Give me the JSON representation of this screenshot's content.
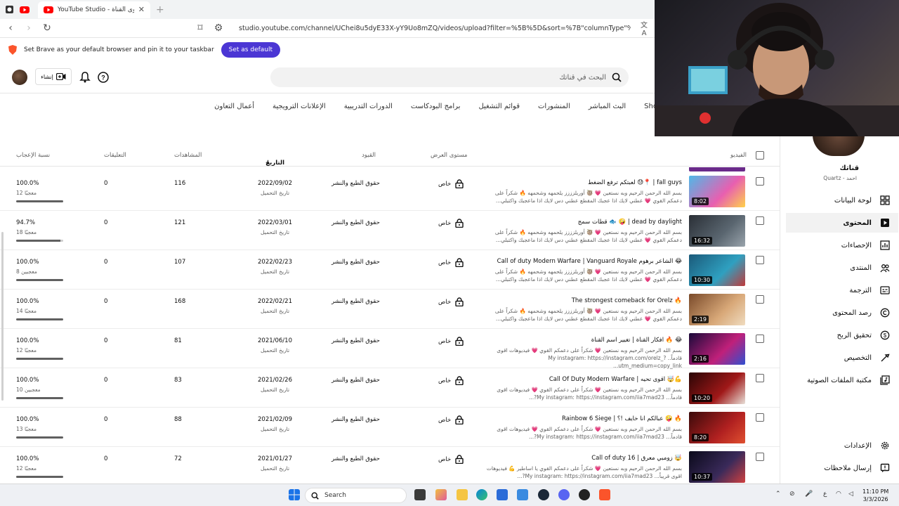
{
  "browser": {
    "tab_title": "YouTube Studio - محتوى القناة",
    "url": "studio.youtube.com/channel/UChei8u5dyE33X-yY9Uo8mZQ/videos/upload?filter=%5B%5D&sort=%7B\"columnType\"%3A\"date\"%2C\"sortOrder...",
    "infobar_text": "Set Brave as your default browser and pin it to your taskbar",
    "infobar_button": "Set as default"
  },
  "header": {
    "create_label": "إنشاء",
    "search_placeholder": "البحث في قناتك"
  },
  "tabs": [
    "Short",
    "البث المباشر",
    "المنشورات",
    "قوائم التشغيل",
    "برامج البودكاست",
    "الدورات التدريبية",
    "الإعلانات الترويجية",
    "أعمال التعاون"
  ],
  "columns": {
    "video": "الفيديو",
    "visibility": "مستوى العرض",
    "restrictions": "القيود",
    "date": "التاريخ",
    "views": "المشاهدات",
    "comments": "التعليقات",
    "likes": "نسبة الإعجاب"
  },
  "rows": [
    {
      "title": "لعبتكم ترفع الضغط 😓📍 | fall guys",
      "desc": "بسم الله الرحمن الرحيم وبه نستعين 💗 🦥 أوريلزززز يلحمهه وشحمهه 🔥 شكراً على دعمكم القوي 💗 عطني لايك اذا عجبك المقطع عطني دس لايك اذا ماعجبك واكتبلي...",
      "duration": "8:02",
      "visibility": "خاص",
      "restrictions": "حقوق الطبع والنشر",
      "date": "2022/09/02",
      "date_sub": "تاريخ التحميل",
      "views": "116",
      "comments": "0",
      "pct": "100.0%",
      "likes": "12 معجبًا",
      "ratio": 1.0,
      "thumb_colors": [
        "#4fb8e8",
        "#e85fb0",
        "#ffd24a"
      ]
    },
    {
      "title": "قطات سمج 🐟 🤪 | dead by daylight",
      "desc": "بسم الله الرحمن الرحيم وبه نستعين 💗 🦥 أوريلزززز يلحمهه وشحمهه 🔥 شكراً على دعمكم القوي 💗 عطني لايك اذا عجبك المقطع عطني دس لايك اذا ماعجبك واكتبلي...",
      "duration": "16:32",
      "visibility": "خاص",
      "restrictions": "حقوق الطبع والنشر",
      "date": "2022/03/01",
      "date_sub": "تاريخ التحميل",
      "views": "121",
      "comments": "0",
      "pct": "94.7%",
      "likes": "18 معجبًا",
      "ratio": 0.947,
      "thumb_colors": [
        "#2a2f36",
        "#5a6670",
        "#9aa4ac"
      ]
    },
    {
      "title": "Call of duty Modern Warfare | Vanguard Royale الشاعر برهوم 😂",
      "desc": "بسم الله الرحمن الرحيم وبه نستعين 💗 🦥 أوريلزززز يلحمهه وشحمهه 🔥 شكراً على دعمكم القوي 💗 عطني لايك اذا عجبك المقطع عطني دس لايك اذا ماعجبك واكتبلي...",
      "duration": "10:30",
      "visibility": "خاص",
      "restrictions": "حقوق الطبع والنشر",
      "date": "2022/02/23",
      "date_sub": "تاريخ التحميل",
      "views": "107",
      "comments": "0",
      "pct": "100.0%",
      "likes": "8 معجبين",
      "ratio": 1.0,
      "thumb_colors": [
        "#1b5a7a",
        "#2fa0c0",
        "#c03a3a"
      ]
    },
    {
      "title": "The strongest comeback for Orelz 🔥",
      "desc": "بسم الله الرحمن الرحيم وبه نستعين 💗 🦥 أوريلزززز يلحمهه وشحمهه 🔥 شكراً على دعمكم القوي 💗 عطني لايك اذا عجبك المقطع عطني دس لايك اذا ماعجبك واكتبلي...",
      "duration": "2:19",
      "visibility": "خاص",
      "restrictions": "حقوق الطبع والنشر",
      "date": "2022/02/21",
      "date_sub": "تاريخ التحميل",
      "views": "168",
      "comments": "0",
      "pct": "100.0%",
      "likes": "14 معجبًا",
      "ratio": 1.0,
      "thumb_colors": [
        "#7a4a2a",
        "#d8a878",
        "#f0dcc0"
      ]
    },
    {
      "title": "افكار القناة | تغيير اسم القناة 🔥 😂",
      "desc": "بسم الله الرحمن الرحيم وبه نستعين 💗 شكراً على دعمكم القوي 💗 فيديوهات اقوى قادماً.. My instagram: https://instagram.com/orelz_?utm_medium=copy_link...",
      "duration": "2:16",
      "visibility": "خاص",
      "restrictions": "حقوق الطبع والنشر",
      "date": "2021/06/10",
      "date_sub": "تاريخ التحميل",
      "views": "81",
      "comments": "0",
      "pct": "100.0%",
      "likes": "12 معجبًا",
      "ratio": 1.0,
      "thumb_colors": [
        "#1a0a3a",
        "#c0207a",
        "#3050d0"
      ]
    },
    {
      "title": "Call Of Duty Modern Warfare | اقوى تحيه 🤯💪",
      "desc": "بسم الله الرحمن الرحيم وبه نستعين 💗 شكراً على دعمكم القوي 💗 فيديوهات اقوى قادماً... My instagram: https://instagram.com/iia7mad23?...",
      "duration": "10:20",
      "visibility": "خاص",
      "restrictions": "حقوق الطبع والنشر",
      "date": "2021/02/26",
      "date_sub": "تاريخ التحميل",
      "views": "83",
      "comments": "0",
      "pct": "100.0%",
      "likes": "10 معجبين",
      "ratio": 1.0,
      "thumb_colors": [
        "#2a0505",
        "#a01818",
        "#e8e0d8"
      ]
    },
    {
      "title": "Rainbow 6 Siege | عبالكم انا خايف !؟ 🤪 🔥",
      "desc": "بسم الله الرحمن الرحيم وبه نستعين 💗 شكراً على دعمكم القوي 💗 فيديوهات اقوى قادماً... My instagram: https://instagram.com/iia7mad23?...",
      "duration": "8:20",
      "visibility": "خاص",
      "restrictions": "حقوق الطبع والنشر",
      "date": "2021/02/09",
      "date_sub": "تاريخ التحميل",
      "views": "88",
      "comments": "0",
      "pct": "100.0%",
      "likes": "13 معجبًا",
      "ratio": 1.0,
      "thumb_colors": [
        "#3a0a0a",
        "#b02020",
        "#e05030"
      ]
    },
    {
      "title": "Call of duty 16 | زومبي معرق 🤯",
      "desc": "بسم الله الرحمن الرحيم وبه نستعين 💗 شكراً على دعمكم القوي يا اساطير 💪 فيديوهات اقوى قريباً... My instagram: https://instagram.com/iia7mad23?...",
      "duration": "10:37",
      "visibility": "خاص",
      "restrictions": "حقوق الطبع والنشر",
      "date": "2021/01/27",
      "date_sub": "تاريخ التحميل",
      "views": "72",
      "comments": "0",
      "pct": "100.0%",
      "likes": "12 معجبًا",
      "ratio": 1.0,
      "thumb_colors": [
        "#0a0a1a",
        "#3a2a5a",
        "#d04040"
      ]
    }
  ],
  "sidebar": {
    "channel_name": "قناتك",
    "channel_sub": "Quartz - احمد",
    "items": [
      {
        "label": "لوحة البيانات",
        "icon": "dashboard-icon"
      },
      {
        "label": "المحتوى",
        "icon": "content-icon",
        "active": true
      },
      {
        "label": "الإحصاءات",
        "icon": "analytics-icon"
      },
      {
        "label": "المنتدى",
        "icon": "community-icon"
      },
      {
        "label": "الترجمة",
        "icon": "subtitles-icon"
      },
      {
        "label": "رصد المحتوى",
        "icon": "copyright-icon"
      },
      {
        "label": "تحقيق الربح",
        "icon": "monetization-icon"
      },
      {
        "label": "التخصيص",
        "icon": "customization-icon"
      },
      {
        "label": "مكتبة الملفات الصوتية",
        "icon": "audio-library-icon"
      }
    ],
    "settings": "الإعدادات",
    "feedback": "إرسال ملاحظات"
  },
  "taskbar": {
    "search": "Search",
    "time": "11:10 PM",
    "date": "3/3/2026",
    "lang": "ع"
  }
}
